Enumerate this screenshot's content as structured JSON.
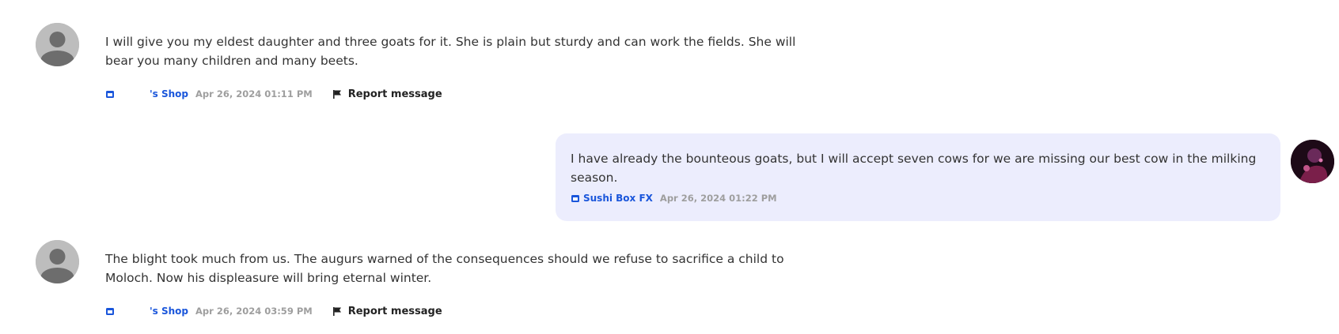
{
  "messages": [
    {
      "text": "I will give you my eldest daughter and three goats for it. She is plain but sturdy and can work the fields. She will bear you many children and many beets.",
      "shop": "'s Shop",
      "timestamp": "Apr 26, 2024 01:11 PM",
      "report_label": "Report message"
    },
    {
      "text": "I have already the bounteous goats, but I will accept seven cows for we are missing our best cow in the milking season.",
      "shop": "Sushi Box FX",
      "timestamp": "Apr 26, 2024 01:22 PM"
    },
    {
      "text": "The blight took much from us. The augurs warned of the consequences should we refuse to sacrifice a child to Moloch. Now his displeasure will bring eternal winter.",
      "shop": "'s Shop",
      "timestamp": "Apr 26, 2024 03:59 PM",
      "report_label": "Report message"
    }
  ],
  "icons": {
    "shop": "shop-icon",
    "report": "flag-icon",
    "avatar_default": "user-avatar-icon"
  },
  "colors": {
    "shop_link": "#1a56db",
    "bubble_bg": "#ecedfd",
    "timestamp": "#9e9e9e"
  }
}
